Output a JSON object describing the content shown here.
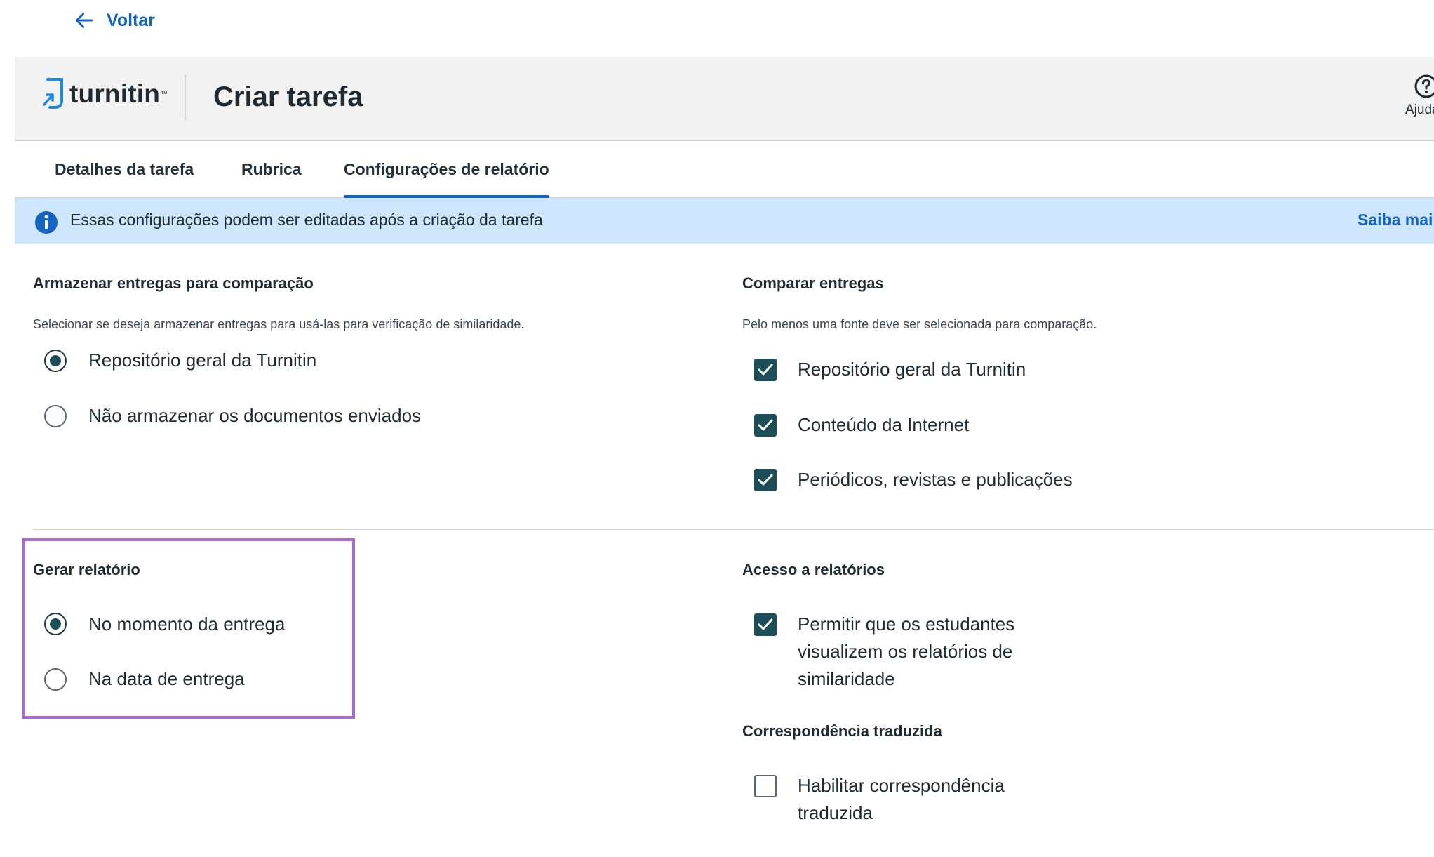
{
  "nav": {
    "back_label": "Voltar"
  },
  "header": {
    "logo_text": "turnitin",
    "title": "Criar tarefa",
    "help_label": "Ajuda"
  },
  "tabs": [
    {
      "label": "Detalhes da tarefa",
      "active": false
    },
    {
      "label": "Rubrica",
      "active": false
    },
    {
      "label": "Configurações de relatório",
      "active": true
    }
  ],
  "banner": {
    "message": "Essas configurações podem ser editadas após a criação da tarefa",
    "link_label": "Saiba mai"
  },
  "store": {
    "title": "Armazenar entregas para comparação",
    "description": "Selecionar se deseja armazenar entregas para usá-las para verificação de similaridade.",
    "options": [
      {
        "label": "Repositório geral da Turnitin",
        "selected": true
      },
      {
        "label": "Não armazenar os documentos enviados",
        "selected": false
      }
    ]
  },
  "compare": {
    "title": "Comparar entregas",
    "description": "Pelo menos uma fonte deve ser selecionada para comparação.",
    "options": [
      {
        "label": "Repositório geral da Turnitin",
        "checked": true
      },
      {
        "label": "Conteúdo da Internet",
        "checked": true
      },
      {
        "label": "Periódicos, revistas e publicações",
        "checked": true
      }
    ]
  },
  "generate": {
    "title": "Gerar relatório",
    "options": [
      {
        "label": "No momento da entrega",
        "selected": true
      },
      {
        "label": "Na data de entrega",
        "selected": false
      }
    ]
  },
  "access": {
    "title": "Acesso a relatórios",
    "option_lines": [
      "Permitir que os estudantes",
      "visualizem os relatórios de",
      "similaridade"
    ],
    "checked": true
  },
  "translated": {
    "title": "Correspondência traduzida",
    "option_lines": [
      "Habilitar correspondência",
      "traduzida"
    ],
    "checked": false
  },
  "colors": {
    "accent": "#1565c0",
    "check": "#1d4e57",
    "banner": "#cde6fb",
    "highlight": "#a66bd1"
  }
}
